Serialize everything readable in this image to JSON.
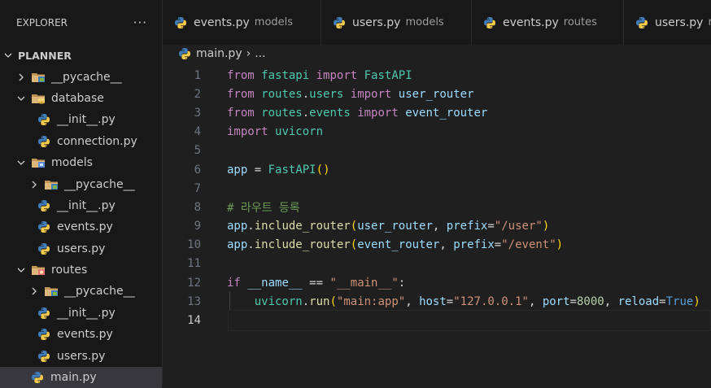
{
  "sidebar": {
    "title": "EXPLORER",
    "more": "···",
    "root": "PLANNER",
    "tree": [
      {
        "label": "__pycache__",
        "type": "folder",
        "expanded": false,
        "depth": 1
      },
      {
        "label": "database",
        "type": "folder",
        "expanded": true,
        "depth": 1
      },
      {
        "label": "__init__.py",
        "type": "file",
        "depth": 2
      },
      {
        "label": "connection.py",
        "type": "file",
        "depth": 2
      },
      {
        "label": "models",
        "type": "folder",
        "expanded": true,
        "depth": 1
      },
      {
        "label": "__pycache__",
        "type": "folder",
        "expanded": false,
        "depth": 2
      },
      {
        "label": "__init__.py",
        "type": "file",
        "depth": 2
      },
      {
        "label": "events.py",
        "type": "file",
        "depth": 2
      },
      {
        "label": "users.py",
        "type": "file",
        "depth": 2
      },
      {
        "label": "routes",
        "type": "folder",
        "expanded": true,
        "depth": 1
      },
      {
        "label": "__pycache__",
        "type": "folder",
        "expanded": false,
        "depth": 2
      },
      {
        "label": "__init__.py",
        "type": "file",
        "depth": 2
      },
      {
        "label": "events.py",
        "type": "file",
        "depth": 2
      },
      {
        "label": "users.py",
        "type": "file",
        "depth": 2
      },
      {
        "label": "main.py",
        "type": "file",
        "depth": 1,
        "selected": true
      }
    ]
  },
  "tabs": [
    {
      "name": "events.py",
      "dir": "models"
    },
    {
      "name": "users.py",
      "dir": "models"
    },
    {
      "name": "events.py",
      "dir": "routes"
    },
    {
      "name": "users.py",
      "dir": "r"
    }
  ],
  "breadcrumb": {
    "file": "main.py",
    "sep": "›",
    "rest": "..."
  },
  "code": {
    "line_numbers": [
      "1",
      "2",
      "3",
      "4",
      "5",
      "6",
      "7",
      "8",
      "9",
      "10",
      "11",
      "12",
      "13",
      "14"
    ],
    "lines": [
      "from fastapi import FastAPI",
      "from routes.users import user_router",
      "from routes.events import event_router",
      "import uvicorn",
      "",
      "app = FastAPI()",
      "",
      "# 라우트 등록",
      "app.include_router(user_router, prefix=\"/user\")",
      "app.include_router(event_router, prefix=\"/event\")",
      "",
      "if __name__ == \"__main__\":",
      "    uvicorn.run(\"main:app\", host=\"127.0.0.1\", port=8000, reload=True)",
      ""
    ]
  },
  "colors": {
    "sidebar_bg": "#181818",
    "editor_bg": "#1f1f1f",
    "selected_bg": "#37373d",
    "python_blue": "#3f7cb8",
    "python_yellow": "#f2c94c"
  }
}
